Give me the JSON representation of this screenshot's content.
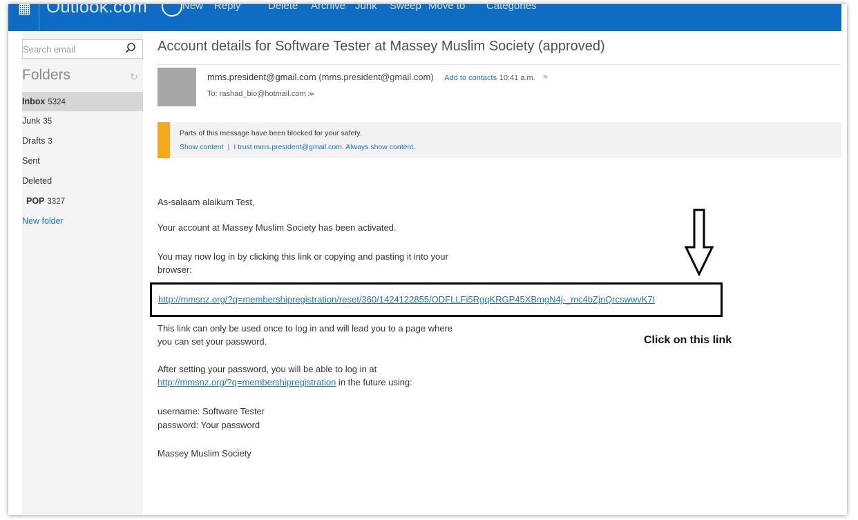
{
  "topbar": {
    "brand": "Outlook.com",
    "items": [
      "New",
      "Reply",
      "Delete",
      "Archive",
      "Junk",
      "Sweep",
      "Move to",
      "Categories"
    ]
  },
  "search": {
    "placeholder": "Search email"
  },
  "folders": {
    "heading": "Folders",
    "items": [
      {
        "label": "Inbox",
        "count": "5324",
        "selected": true
      },
      {
        "label": "Junk",
        "count": "35"
      },
      {
        "label": "Drafts",
        "count": "3"
      },
      {
        "label": "Sent",
        "count": ""
      },
      {
        "label": "Deleted",
        "count": ""
      },
      {
        "label": "POP",
        "count": "3327"
      }
    ],
    "new_folder": "New folder"
  },
  "message": {
    "subject": "Account details for Software Tester at Massey Muslim Society (approved)",
    "from_email": "mms.president@gmail.com",
    "from_display": "(mms.president@gmail.com)",
    "add_to_contacts": "Add to contacts",
    "time": "10:41 a.m.",
    "to": "To: rashad_bio@hotmail.com",
    "warning_text": "Parts of this message have been blocked for your safety.",
    "show_content": "Show content",
    "trust_link": "I trust mms.president@gmail.com. Always show content.",
    "greeting": "As-salaam alaikum Test,",
    "line_activated": "Your account at Massey Muslim Society has been activated.",
    "line_login_1": "You may now log in by clicking this link or copying and pasting it into your",
    "line_login_2": "browser:",
    "reset_link": "http://mmsnz.org/?q=membershipregistration/reset/360/1424122855/ODFLLFi5RgqKRGP45XBmgN4j-_mc4bZjnQrcswwvK7I",
    "line_once_1": "This link can only be used once to log in and will lead you to a page where",
    "line_once_2": "you can set your password.",
    "line_after_1": "After setting your password, you will be able to log in at",
    "registration_link": "http://mmsnz.org/?q=membershipregistration",
    "line_after_2": " in the future using:",
    "username_line": "username: Software Tester",
    "password_line": "password: Your password",
    "signature": "Massey Muslim Society"
  },
  "annotation": {
    "text": "Click on this link"
  },
  "colors": {
    "topbar": "#0f6cc4",
    "link": "#1a73c9",
    "warning_bar": "#f5a81c"
  }
}
